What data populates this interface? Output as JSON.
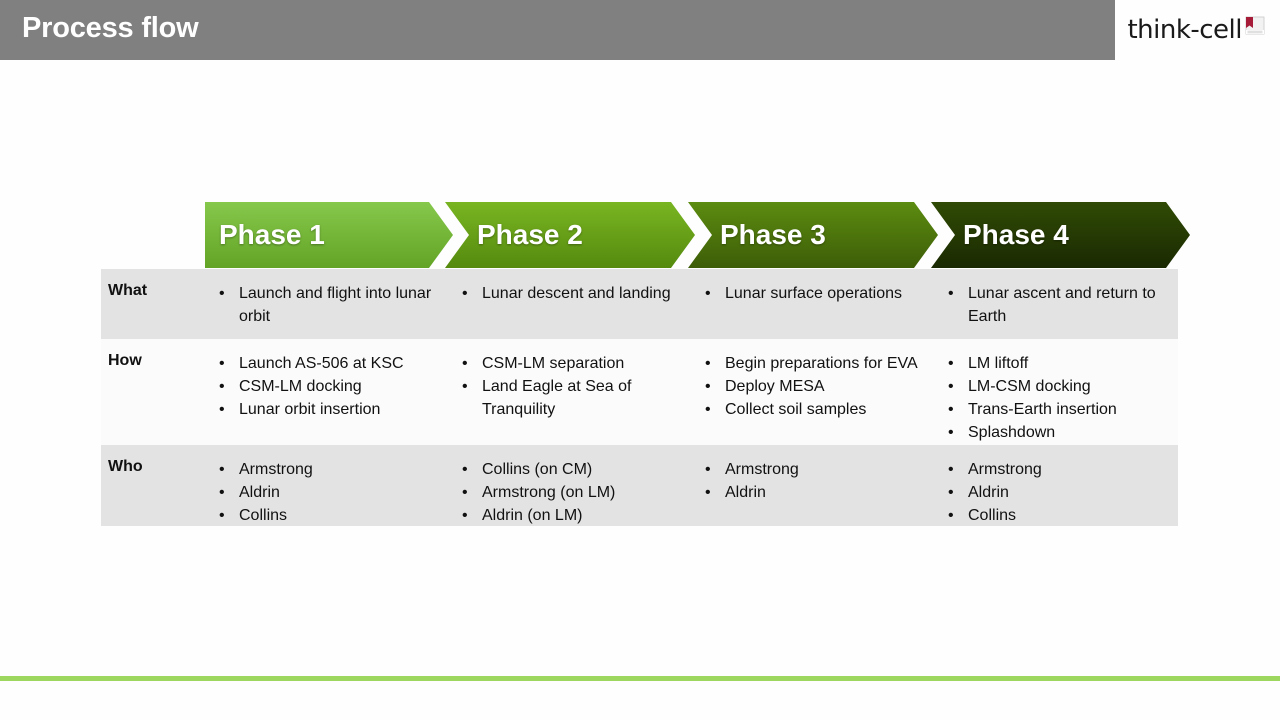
{
  "slide": {
    "title": "Process flow",
    "brand": {
      "name": "think-cell",
      "logo_icon": "think-cell-page-mark-icon",
      "accent_red": "#a61c38"
    },
    "colors": {
      "title_bar": "#808080",
      "title_text": "#ffffff",
      "bottom_accent": "#9ed75f",
      "row_shaded": "#e3e3e3",
      "row_light": "#fbfbfb",
      "text": "#111111"
    }
  },
  "phases": [
    {
      "label": "Phase 1",
      "color_from": "#7dbe3e",
      "color_to": "#6aae2c"
    },
    {
      "label": "Phase 2",
      "color_from": "#6faa1e",
      "color_to": "#5d9311"
    },
    {
      "label": "Phase 3",
      "color_from": "#54820f",
      "color_to": "#44680a"
    },
    {
      "label": "Phase 4",
      "color_from": "#2c4405",
      "color_to": "#1d2e02"
    }
  ],
  "rows": [
    {
      "label": "What",
      "cells": [
        [
          "Launch and flight into lunar orbit"
        ],
        [
          "Lunar descent and landing"
        ],
        [
          "Lunar surface operations"
        ],
        [
          "Lunar ascent and return to Earth"
        ]
      ]
    },
    {
      "label": "How",
      "cells": [
        [
          "Launch AS-506 at KSC",
          "CSM-LM docking",
          "Lunar orbit insertion"
        ],
        [
          "CSM-LM separation",
          "Land Eagle at Sea of Tranquility"
        ],
        [
          "Begin preparations for EVA",
          "Deploy MESA",
          "Collect soil samples"
        ],
        [
          "LM liftoff",
          "LM-CSM docking",
          "Trans-Earth insertion",
          "Splashdown"
        ]
      ]
    },
    {
      "label": "Who",
      "cells": [
        [
          "Armstrong",
          "Aldrin",
          "Collins"
        ],
        [
          "Collins (on CM)",
          "Armstrong (on LM)",
          "Aldrin (on LM)"
        ],
        [
          "Armstrong",
          "Aldrin"
        ],
        [
          "Armstrong",
          "Aldrin",
          "Collins"
        ]
      ]
    }
  ],
  "bullet_glyph": "•"
}
